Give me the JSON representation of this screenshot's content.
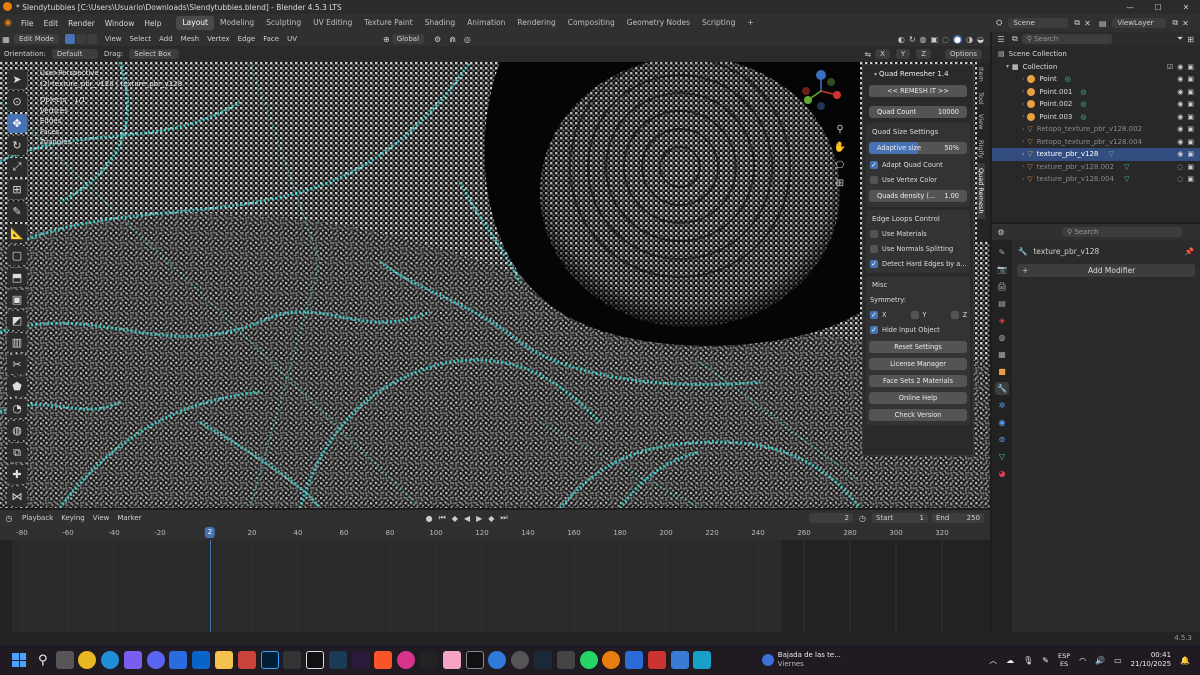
{
  "window": {
    "title": "* Slendytubbies [C:\\Users\\Usuario\\Downloads\\Slendytubbies.blend] - Blender 4.5.3 LTS",
    "controls": [
      "—",
      "☐",
      "✕"
    ]
  },
  "menu": {
    "items": [
      "File",
      "Edit",
      "Render",
      "Window",
      "Help"
    ],
    "workspaces": [
      "Layout",
      "Modeling",
      "Sculpting",
      "UV Editing",
      "Texture Paint",
      "Shading",
      "Animation",
      "Rendering",
      "Compositing",
      "Geometry Nodes",
      "Scripting"
    ],
    "active_workspace": "Layout",
    "add_tab": "+",
    "scene_label": "Scene",
    "viewlayer_label": "ViewLayer"
  },
  "viewport_header": {
    "mode": "Edit Mode",
    "menus": [
      "View",
      "Select",
      "Add",
      "Mesh",
      "Vertex",
      "Edge",
      "Face",
      "UV"
    ],
    "transform": "Global",
    "orientation_label": "Orientation:",
    "orientation_value": "Default",
    "drag_label": "Drag:",
    "drag_value": "Select Box",
    "axes": [
      "X",
      "Y",
      "Z"
    ],
    "options": "Options"
  },
  "viewport_info": {
    "perspective": "User Perspective",
    "object_path": "(2) texture_pbr_v128 | texture_pbr_v128",
    "objects_label": "Objects",
    "objects_value": "1/1",
    "stats": [
      {
        "label": "Vertices",
        "value": "…"
      },
      {
        "label": "Edges",
        "value": "…"
      },
      {
        "label": "Faces",
        "value": "…"
      },
      {
        "label": "Triangles",
        "value": "…"
      }
    ]
  },
  "tool_icons": [
    "cursor",
    "move",
    "rotate",
    "scale",
    "transform",
    "annotate",
    "measure",
    "add-cube",
    "extrude",
    "inset",
    "bevel",
    "loop-cut",
    "knife",
    "poly-build",
    "spin",
    "smooth",
    "edge-slide",
    "shrink",
    "shear",
    "rip"
  ],
  "sidebar_tabs": [
    "Item",
    "Tool",
    "View",
    "Rigify",
    "Quad Remesh"
  ],
  "quad_remesher": {
    "title": "Quad Remesher 1.4",
    "remesh_button": "<< REMESH IT >>",
    "quad_count_label": "Quad Count",
    "quad_count_value": "10000",
    "size_section": "Quad Size Settings",
    "adaptive_label": "Adaptive size",
    "adaptive_value": "50%",
    "adaptive_fraction": 0.5,
    "adapt_quad_count": "Adapt Quad Count",
    "use_vertex_color": "Use Vertex Color",
    "quads_density_label": "Quads density (...",
    "quads_density_value": "1.00",
    "edge_section": "Edge Loops Control",
    "use_materials": "Use Materials",
    "use_normals": "Use Normals Splitting",
    "detect_hard": "Detect Hard Edges by a...",
    "misc_section": "Misc",
    "symmetry_label": "Symmetry:",
    "sym_x": "X",
    "sym_y": "Y",
    "sym_z": "Z",
    "hide_input": "Hide Input Object",
    "reset": "Reset Settings",
    "license": "License Manager",
    "face_sets": "Face Sets 2 Materials",
    "help": "Online Help",
    "version": "Check Version"
  },
  "timeline": {
    "menus": [
      "Playback",
      "Keying",
      "View",
      "Marker"
    ],
    "current_frame": "2",
    "start_label": "Start",
    "start_value": "1",
    "end_label": "End",
    "end_value": "250",
    "ticks": [
      "-80",
      "-60",
      "-40",
      "-20",
      "2",
      "20",
      "40",
      "60",
      "80",
      "100",
      "120",
      "140",
      "160",
      "180",
      "200",
      "220",
      "240",
      "260",
      "280",
      "300",
      "320"
    ]
  },
  "outliner": {
    "search_placeholder": "Search",
    "scene_collection": "Scene Collection",
    "collection": "Collection",
    "items": [
      {
        "name": "Point",
        "dim": false,
        "selected": false,
        "color": "#e8a040"
      },
      {
        "name": "Point.001",
        "dim": false,
        "selected": false,
        "color": "#e8a040"
      },
      {
        "name": "Point.002",
        "dim": false,
        "selected": false,
        "color": "#e8a040"
      },
      {
        "name": "Point.003",
        "dim": false,
        "selected": false,
        "color": "#e8a040"
      },
      {
        "name": "Retopo_texture_pbr_v128.002",
        "dim": true,
        "selected": false,
        "color": "#e8a040"
      },
      {
        "name": "Retopo_texture_pbr_v128.004",
        "dim": true,
        "selected": false,
        "color": "#e8a040"
      },
      {
        "name": "texture_pbr_v128",
        "dim": false,
        "selected": true,
        "color": "#e8a040"
      },
      {
        "name": "texture_pbr_v128.002",
        "dim": true,
        "selected": false,
        "color": "#e8a040"
      },
      {
        "name": "texture_pbr_v128.004",
        "dim": true,
        "selected": false,
        "color": "#e8a040"
      }
    ]
  },
  "properties": {
    "search_placeholder": "Search",
    "object_name": "texture_pbr_v128",
    "add_modifier": "Add Modifier"
  },
  "status": {
    "version": "4.5.3"
  },
  "taskbar": {
    "news": "Bajada de las te...",
    "news_sub": "Viernes",
    "lang": "ESP",
    "lang_sub": "ES",
    "time": "00:41",
    "date": "21/10/2025"
  },
  "colors": {
    "accent": "#4772b3",
    "mesh_cyan": "#3fd6d0",
    "timeline_cursor": "#4772b3"
  }
}
